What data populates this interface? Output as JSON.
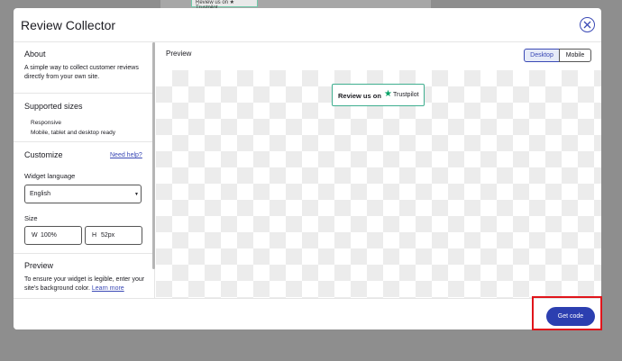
{
  "background": {
    "peek_text": "Review us on ★ Trustpilot"
  },
  "modal": {
    "title": "Review Collector"
  },
  "sidebar": {
    "about_title": "About",
    "about_text": "A simple way to collect customer reviews directly from your own site.",
    "sizes_title": "Supported sizes",
    "sizes_line1": "Responsive",
    "sizes_line2": "Mobile, tablet and desktop ready",
    "customize_title": "Customize",
    "need_help": "Need help?",
    "language_label": "Widget language",
    "language_value": "English",
    "size_label": "Size",
    "width_label": "W",
    "width_value": "100%",
    "height_label": "H",
    "height_value": "52px",
    "preview_title": "Preview",
    "preview_text": "To ensure your widget is legible, enter your site's background color.",
    "learn_more": "Learn more"
  },
  "preview": {
    "title": "Preview",
    "desktop_label": "Desktop",
    "mobile_label": "Mobile",
    "widget_text": "Review us on",
    "widget_brand": "Trustpilot"
  },
  "footer": {
    "get_code_label": "Get code"
  },
  "colors": {
    "accent": "#2c3fb0",
    "trustpilot_green": "#04a266",
    "highlight": "#e0151b"
  }
}
